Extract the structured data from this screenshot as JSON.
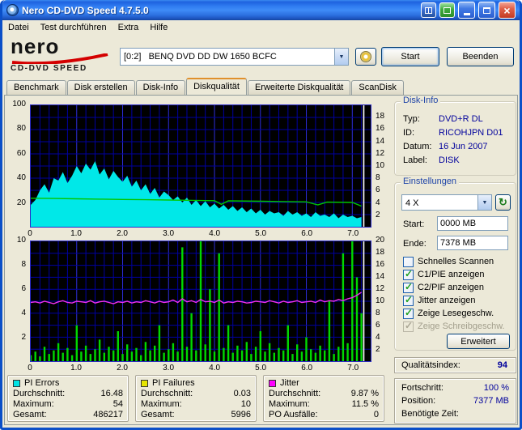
{
  "window": {
    "title": "Nero CD-DVD Speed 4.7.5.0"
  },
  "icons": {
    "dropdown": "▼",
    "close": "×",
    "refresh": "↻"
  },
  "menu": {
    "items": [
      {
        "label": "Datei"
      },
      {
        "label": "Test durchführen"
      },
      {
        "label": "Extra"
      },
      {
        "label": "Hilfe"
      }
    ]
  },
  "logo": {
    "brand": "nero",
    "product": "CD-DVD SPEED"
  },
  "toolbar": {
    "drive_value": "[0:2]   BENQ DVD DD DW 1650 BCFC",
    "start_label": "Start",
    "quit_label": "Beenden"
  },
  "tabs": {
    "items": [
      {
        "label": "Benchmark"
      },
      {
        "label": "Disk erstellen"
      },
      {
        "label": "Disk-Info"
      },
      {
        "label": "Diskqualität"
      },
      {
        "label": "Erweiterte Diskqualität"
      },
      {
        "label": "ScanDisk"
      }
    ]
  },
  "disk_info": {
    "title": "Disk-Info",
    "rows": [
      {
        "label": "Typ:",
        "value": "DVD+R DL"
      },
      {
        "label": "ID:",
        "value": "RICOHJPN D01"
      },
      {
        "label": "Datum:",
        "value": "16 Jun 2007"
      },
      {
        "label": "Label:",
        "value": "DISK"
      }
    ]
  },
  "settings": {
    "title": "Einstellungen",
    "speed_value": "4 X",
    "start_label": "Start:",
    "start_value": "0000 MB",
    "end_label": "Ende:",
    "end_value": "7378 MB",
    "checkboxes": [
      {
        "label": "Schnelles Scannen",
        "mark": ""
      },
      {
        "label": "C1/PIE anzeigen",
        "mark": "✓"
      },
      {
        "label": "C2/PIF anzeigen",
        "mark": "✓"
      },
      {
        "label": "Jitter anzeigen",
        "mark": "✓"
      },
      {
        "label": "Zeige Lesegeschw.",
        "mark": "✓"
      },
      {
        "label": "Zeige Schreibgeschw.",
        "mark": "✓"
      }
    ],
    "advanced_label": "Erweitert"
  },
  "quality": {
    "label": "Qualitätsindex:",
    "value": "94"
  },
  "progress": {
    "rows": [
      {
        "label": "Fortschritt:",
        "value": "100 %"
      },
      {
        "label": "Position:",
        "value": "7377 MB"
      },
      {
        "label": "Benötigte Zeit:",
        "value": ""
      }
    ]
  },
  "stats": {
    "pie": {
      "title": "PI Errors",
      "color": "#00E4E4",
      "rows": [
        {
          "label": "Durchschnitt:",
          "value": "16.48"
        },
        {
          "label": "Maximum:",
          "value": "54"
        },
        {
          "label": "Gesamt:",
          "value": "486217"
        }
      ]
    },
    "pif": {
      "title": "PI Failures",
      "color": "#E6E600",
      "rows": [
        {
          "label": "Durchschnitt:",
          "value": "0.03"
        },
        {
          "label": "Maximum:",
          "value": "10"
        },
        {
          "label": "Gesamt:",
          "value": "5996"
        }
      ]
    },
    "jitter": {
      "title": "Jitter",
      "color": "#FF00FF",
      "rows": [
        {
          "label": "Durchschnitt:",
          "value": "9.87 %"
        },
        {
          "label": "Maximum:",
          "value": "11.5 %"
        },
        {
          "label": "PO Ausfälle:",
          "value": "0"
        }
      ]
    }
  },
  "chart_data": [
    {
      "type": "area",
      "name": "pi-errors-and-read-speed",
      "x_max": 7.4,
      "x_unit": "GB",
      "x_grid_step": 0.2,
      "left_axis_max": 100,
      "right_axis_max": 20,
      "left_labels": [
        "100",
        "80",
        "60",
        "40",
        "20"
      ],
      "left_start_pct": 0,
      "left_step_pct": 20,
      "right_labels": [
        "18",
        "16",
        "14",
        "12",
        "10",
        "8",
        "6",
        "4",
        "2"
      ],
      "right_start_pct": 10,
      "right_step_pct": 10,
      "x_labels": [
        "0",
        "1.0",
        "2.0",
        "3.0",
        "4.0",
        "5.0",
        "6.0",
        "7.0"
      ],
      "end_line_x": 7.25,
      "series": [
        {
          "name": "pi-errors",
          "style": "area",
          "color": "#00E8E8",
          "axis": "left",
          "x0": 0,
          "x_step": 0.1,
          "values": [
            18,
            22,
            30,
            35,
            28,
            40,
            38,
            45,
            36,
            42,
            50,
            44,
            52,
            47,
            54,
            43,
            48,
            39,
            46,
            41,
            37,
            42,
            33,
            38,
            30,
            35,
            27,
            32,
            24,
            29,
            26,
            22,
            25,
            20,
            24,
            18,
            22,
            17,
            21,
            16,
            19,
            15,
            18,
            14,
            17,
            13,
            16,
            12,
            15,
            11,
            14,
            10,
            13,
            11,
            12,
            9,
            13,
            10,
            12,
            9,
            11,
            8,
            12,
            9,
            10,
            8,
            11,
            7,
            10,
            8,
            9,
            7,
            8
          ]
        },
        {
          "name": "read-speed",
          "style": "line",
          "color": "#00C800",
          "axis": "right",
          "points": [
            [
              0,
              4.7
            ],
            [
              0.5,
              4.65
            ],
            [
              1.0,
              4.6
            ],
            [
              1.5,
              4.55
            ],
            [
              2.0,
              4.5
            ],
            [
              2.5,
              4.45
            ],
            [
              3.0,
              4.4
            ],
            [
              3.5,
              4.35
            ],
            [
              4.0,
              4.3
            ],
            [
              4.15,
              3.7
            ],
            [
              4.3,
              4.27
            ],
            [
              5.0,
              4.2
            ],
            [
              5.5,
              4.15
            ],
            [
              6.0,
              4.1
            ],
            [
              6.25,
              3.6
            ],
            [
              6.45,
              4.05
            ],
            [
              7.0,
              4.0
            ],
            [
              7.2,
              3.4
            ]
          ]
        }
      ]
    },
    {
      "type": "bar",
      "name": "pi-failures-and-jitter",
      "x_max": 7.4,
      "x_unit": "GB",
      "x_grid_step": 0.2,
      "left_axis_max": 10,
      "right_axis_max": 20,
      "left_labels": [
        "10",
        "8",
        "6",
        "4",
        "2"
      ],
      "left_start_pct": 0,
      "left_step_pct": 20,
      "right_labels": [
        "20",
        "18",
        "16",
        "14",
        "12",
        "10",
        "8",
        "6",
        "4",
        "2"
      ],
      "right_start_pct": 0,
      "right_step_pct": 10,
      "x_labels": [
        "0",
        "1.0",
        "2.0",
        "3.0",
        "4.0",
        "5.0",
        "6.0",
        "7.0"
      ],
      "end_line_x": 7.25,
      "series": [
        {
          "name": "pi-failures",
          "style": "bars",
          "color": "#00D800",
          "axis": "left",
          "x0": 0,
          "x_step": 0.1,
          "values": [
            0.5,
            0.8,
            0.4,
            1.2,
            0.6,
            0.9,
            1.5,
            0.7,
            1.1,
            0.5,
            3.0,
            0.8,
            1.3,
            0.6,
            1.0,
            1.8,
            0.7,
            1.2,
            0.9,
            2.5,
            0.6,
            1.4,
            0.8,
            1.1,
            0.5,
            1.6,
            0.9,
            1.3,
            3.0,
            0.7,
            1.0,
            1.5,
            0.8,
            9.5,
            1.2,
            4.0,
            0.9,
            10.0,
            1.4,
            6.0,
            0.8,
            9.0,
            1.1,
            3.0,
            0.7,
            1.3,
            0.9,
            1.6,
            0.6,
            1.2,
            2.5,
            0.8,
            1.5,
            0.7,
            1.1,
            0.9,
            3.0,
            0.6,
            1.4,
            0.8,
            2.0,
            1.0,
            0.7,
            1.3,
            0.9,
            5.0,
            0.6,
            1.2,
            9.0,
            1.5,
            10.0,
            7.0,
            4.0
          ]
        },
        {
          "name": "jitter",
          "style": "line",
          "color": "#F030F0",
          "axis": "right",
          "x0": 0,
          "x_step": 0.1,
          "values": [
            9.8,
            9.9,
            9.7,
            10.0,
            9.8,
            9.6,
            9.9,
            10.1,
            9.8,
            9.7,
            10.0,
            9.9,
            9.8,
            10.1,
            9.7,
            9.9,
            10.0,
            9.8,
            9.6,
            9.9,
            9.8,
            10.0,
            9.7,
            9.9,
            9.8,
            10.1,
            9.9,
            9.7,
            10.0,
            9.8,
            9.9,
            10.2,
            9.8,
            10.4,
            9.9,
            10.1,
            9.8,
            10.3,
            9.9,
            10.0,
            9.8,
            10.2,
            9.7,
            9.9,
            9.8,
            10.0,
            9.9,
            9.7,
            9.8,
            10.0,
            9.9,
            9.8,
            10.1,
            9.9,
            9.7,
            10.0,
            9.8,
            9.9,
            10.1,
            9.8,
            9.9,
            10.0,
            9.8,
            10.2,
            9.9,
            10.1,
            10.0,
            10.3,
            10.1,
            10.4,
            10.6,
            11.0,
            11.5
          ]
        }
      ]
    }
  ]
}
